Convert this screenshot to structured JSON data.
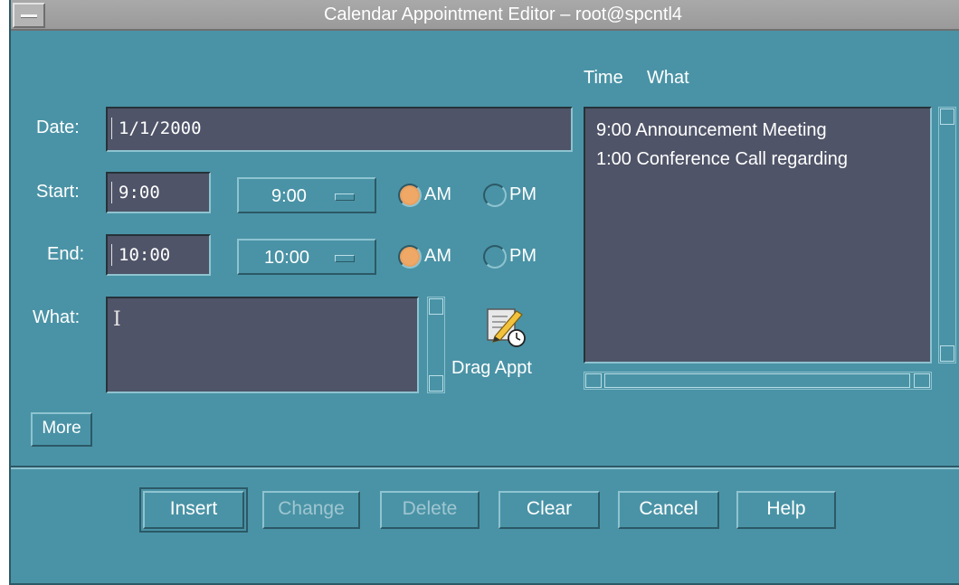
{
  "window": {
    "title": "Calendar Appointment Editor – root@spcntl4"
  },
  "form": {
    "date_label": "Date:",
    "date_value": "1/1/2000",
    "start_label": "Start:",
    "start_value": "9:00",
    "start_option": "9:00",
    "end_label": "End:",
    "end_value": "10:00",
    "end_option": "10:00",
    "am_label": "AM",
    "pm_label": "PM",
    "start_ampm": "AM",
    "end_ampm": "AM",
    "what_label": "What:",
    "what_value": "",
    "drag_label": "Drag Appt",
    "more_label": "More"
  },
  "list": {
    "header_time": "Time",
    "header_what": "What",
    "rows": [
      "9:00 Announcement Meeting",
      "1:00 Conference Call regarding"
    ]
  },
  "buttons": {
    "insert": "Insert",
    "change": "Change",
    "delete": "Delete",
    "clear": "Clear",
    "cancel": "Cancel",
    "help": "Help"
  },
  "colors": {
    "background": "#4a93a6",
    "field": "#4f5468",
    "radio_selected": "#f0a866",
    "titlebar": "#a5a5a5"
  },
  "icons": {
    "drag_appt": "pencil-clock-icon",
    "window_menu": "window-menu-icon"
  }
}
